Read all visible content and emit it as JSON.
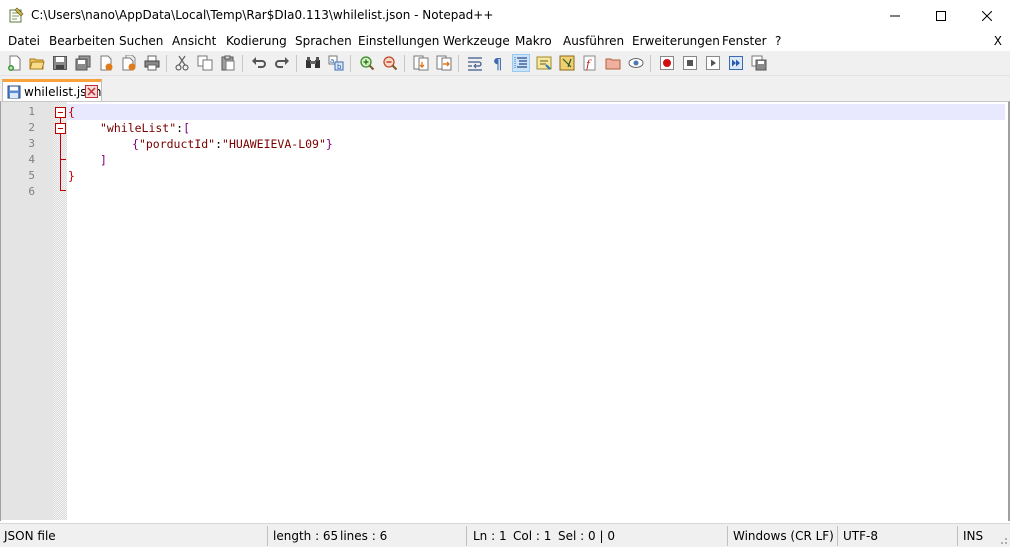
{
  "window": {
    "title": "C:\\Users\\nano\\AppData\\Local\\Temp\\Rar$DIa0.113\\whilelist.json - Notepad++"
  },
  "menu": {
    "items": [
      "Datei",
      "Bearbeiten",
      "Suchen",
      "Ansicht",
      "Kodierung",
      "Sprachen",
      "Einstellungen",
      "Werkzeuge",
      "Makro",
      "Ausführen",
      "Erweiterungen",
      "Fenster",
      "?"
    ],
    "close_label": "X"
  },
  "toolbar": {
    "buttons": [
      "new-file-icon",
      "open-file-icon",
      "save-icon",
      "save-all-icon",
      "close-icon",
      "close-all-icon",
      "print-icon",
      "cut-icon",
      "copy-icon",
      "paste-icon",
      "undo-icon",
      "redo-icon",
      "find-icon",
      "replace-icon",
      "zoom-in-icon",
      "zoom-out-icon",
      "sync-vertical-icon",
      "sync-horizontal-icon",
      "word-wrap-icon",
      "show-all-chars-icon",
      "indent-guide-icon",
      "user-defined-lang-icon",
      "doc-map-icon",
      "function-list-icon",
      "folder-as-workspace-icon",
      "monitoring-icon",
      "record-macro-icon",
      "stop-record-icon",
      "play-macro-icon",
      "run-macro-multiple-icon",
      "save-macro-icon"
    ]
  },
  "tab": {
    "label": "whilelist.json",
    "close_icon": "tab-close-icon"
  },
  "editor": {
    "line_numbers": [
      "1",
      "2",
      "3",
      "4",
      "5",
      "6"
    ],
    "lines": [
      {
        "t1": "{"
      },
      {
        "t1": "\"whileList\"",
        "t2": ":",
        "t3": "["
      },
      {
        "t1": "{",
        "t2": "\"porductId\"",
        "t3": ":",
        "t4": "\"HUAWEIEVA-L09\"",
        "t5": "}"
      },
      {
        "t1": "]"
      },
      {
        "t1": "}"
      },
      {}
    ]
  },
  "status": {
    "file_type": "JSON file",
    "length": "length : 65",
    "lines": "lines : 6",
    "ln": "Ln : 1",
    "col": "Col : 1",
    "sel": "Sel : 0 | 0",
    "eol": "Windows (CR LF)",
    "encoding": "UTF-8",
    "mode": "INS"
  },
  "colors": {
    "tab_accent": "#f9a23b",
    "caret_line": "#e8e8ff",
    "fold_marker": "#c00000",
    "key_text": "#7a0000",
    "bracket_text": "#800080"
  }
}
